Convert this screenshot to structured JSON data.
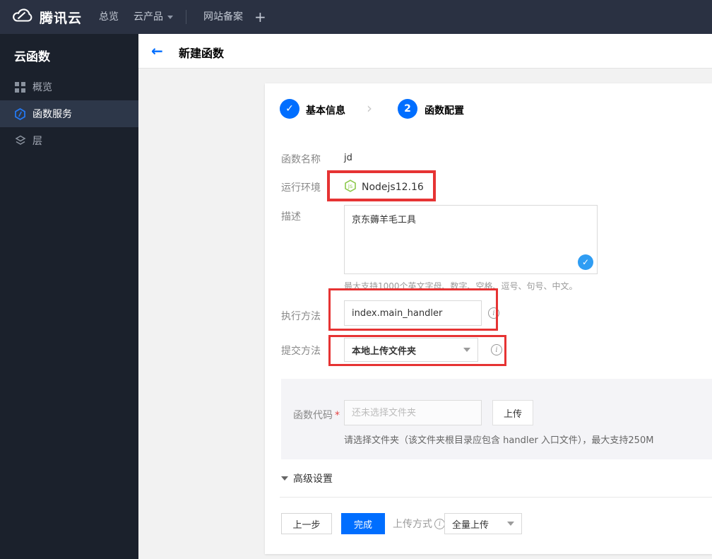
{
  "topnav": {
    "brand": "腾讯云",
    "items": [
      {
        "label": "总览"
      },
      {
        "label": "云产品"
      },
      {
        "label": "网站备案"
      },
      {
        "label": "+"
      }
    ]
  },
  "sidebar": {
    "title": "云函数",
    "items": [
      {
        "label": "概览",
        "icon": "grid-icon",
        "active": false
      },
      {
        "label": "函数服务",
        "icon": "function-hexagon-icon",
        "active": true
      },
      {
        "label": "层",
        "icon": "layers-icon",
        "active": false
      }
    ]
  },
  "header": {
    "back_glyph": "←",
    "title": "新建函数"
  },
  "steps": [
    {
      "label": "基本信息",
      "state": "done",
      "glyph": "✓"
    },
    {
      "label": "函数配置",
      "state": "current",
      "number": "2"
    }
  ],
  "step_separator": "›",
  "form": {
    "function_name": {
      "label": "函数名称",
      "value": "jd"
    },
    "runtime": {
      "label": "运行环境",
      "value": "Nodejs12.16",
      "icon": "nodejs-icon"
    },
    "description": {
      "label": "描述",
      "value": "京东薅羊毛工具",
      "check_glyph": "✓",
      "hint": "最大支持1000个英文字母、数字、空格、逗号、句号、中文。"
    },
    "handler": {
      "label": "执行方法",
      "value": "index.main_handler",
      "info_glyph": "i"
    },
    "submit_method": {
      "label": "提交方法",
      "value": "本地上传文件夹",
      "info_glyph": "i"
    },
    "function_code": {
      "label": "函数代码",
      "required_mark": "*",
      "placeholder": "还未选择文件夹",
      "upload_button": "上传",
      "hint": "请选择文件夹（该文件夹根目录应包含 handler 入口文件），最大支持250M"
    },
    "advanced_label": "高级设置"
  },
  "footer": {
    "prev_button": "上一步",
    "finish_button": "完成",
    "upload_mode_label": "上传方式",
    "upload_mode_info_glyph": "i",
    "upload_mode_value": "全量上传"
  },
  "colors": {
    "accent_blue": "#006eff",
    "topnav_bg": "#2a3142",
    "sidebar_bg": "#1b212c",
    "sidebar_active_bg": "#2d3749",
    "annotation_red": "#e63333",
    "nodejs_green": "#8cc84b",
    "check_bubble_blue": "#2f9df3"
  }
}
